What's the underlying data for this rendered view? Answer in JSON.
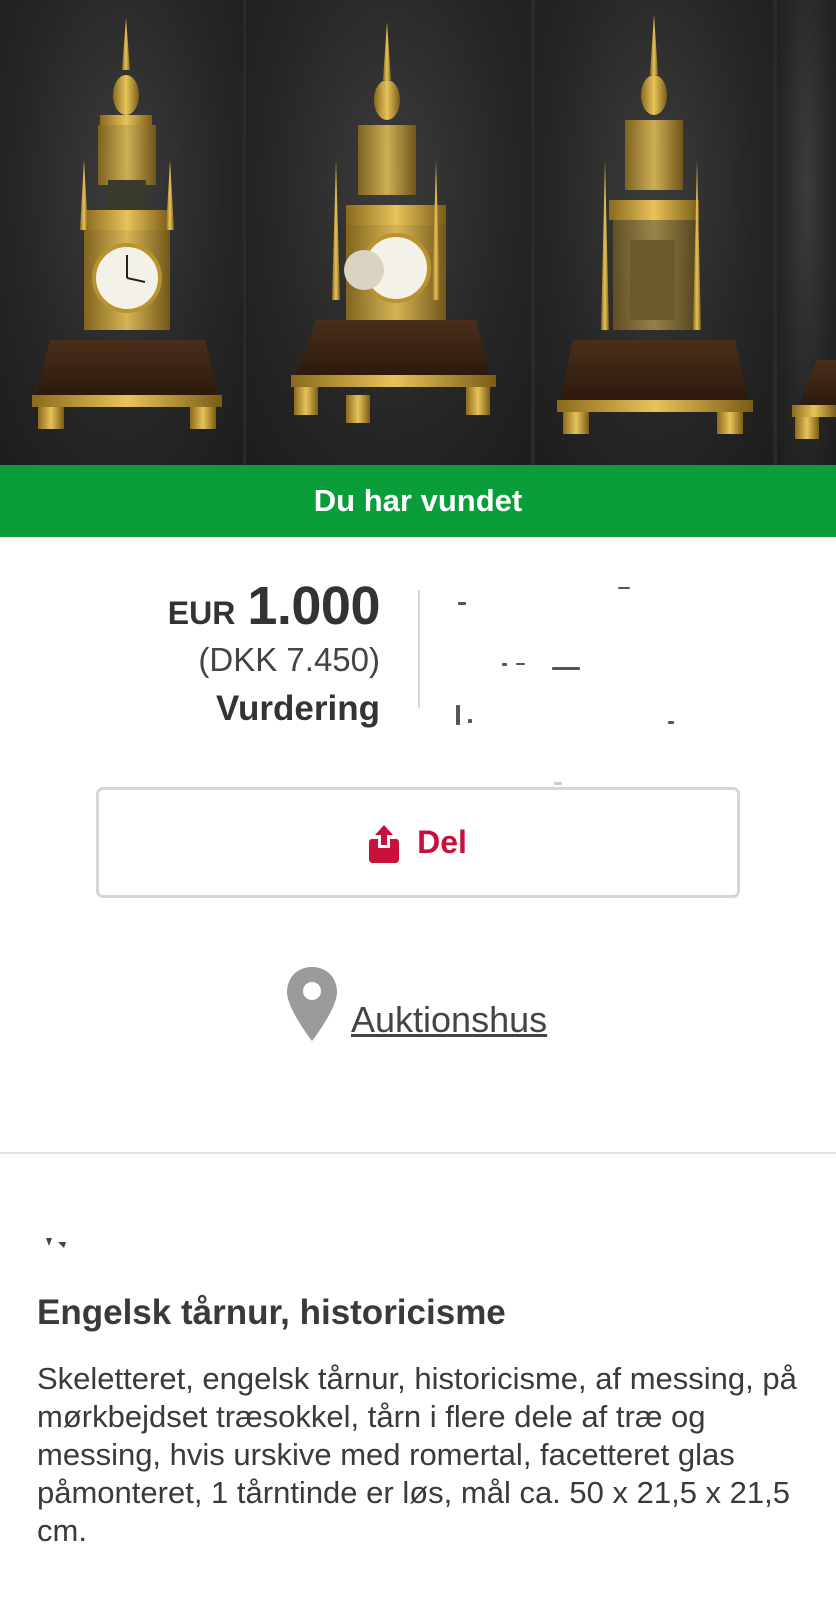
{
  "gallery": {
    "photos": [
      {
        "alt": "clock-front"
      },
      {
        "alt": "clock-angle"
      },
      {
        "alt": "clock-side"
      },
      {
        "alt": "clock-partial"
      }
    ]
  },
  "banner": {
    "text": "Du har vundet"
  },
  "price": {
    "currency": "EUR",
    "amount": "1.000",
    "converted": "(DKK 7.450)",
    "label": "Vurdering"
  },
  "share": {
    "label": "Del",
    "icon": "share-icon",
    "color": "#c8103a"
  },
  "location": {
    "link_text": "Auktionshus",
    "icon": "map-pin-icon"
  },
  "lot": {
    "title": "Engelsk tårnur, historicisme",
    "description": "Skeletteret, engelsk tårnur, historicisme, af messing, på mørkbejdset træsokkel, tårn i flere dele af træ og messing, hvis urskive med romertal, facetteret glas påmonteret, 1 tårntinde er løs, mål ca. 50 x 21,5 x 21,5 cm."
  },
  "colors": {
    "banner_green": "#0a9e3a",
    "accent_red": "#c8103a"
  }
}
